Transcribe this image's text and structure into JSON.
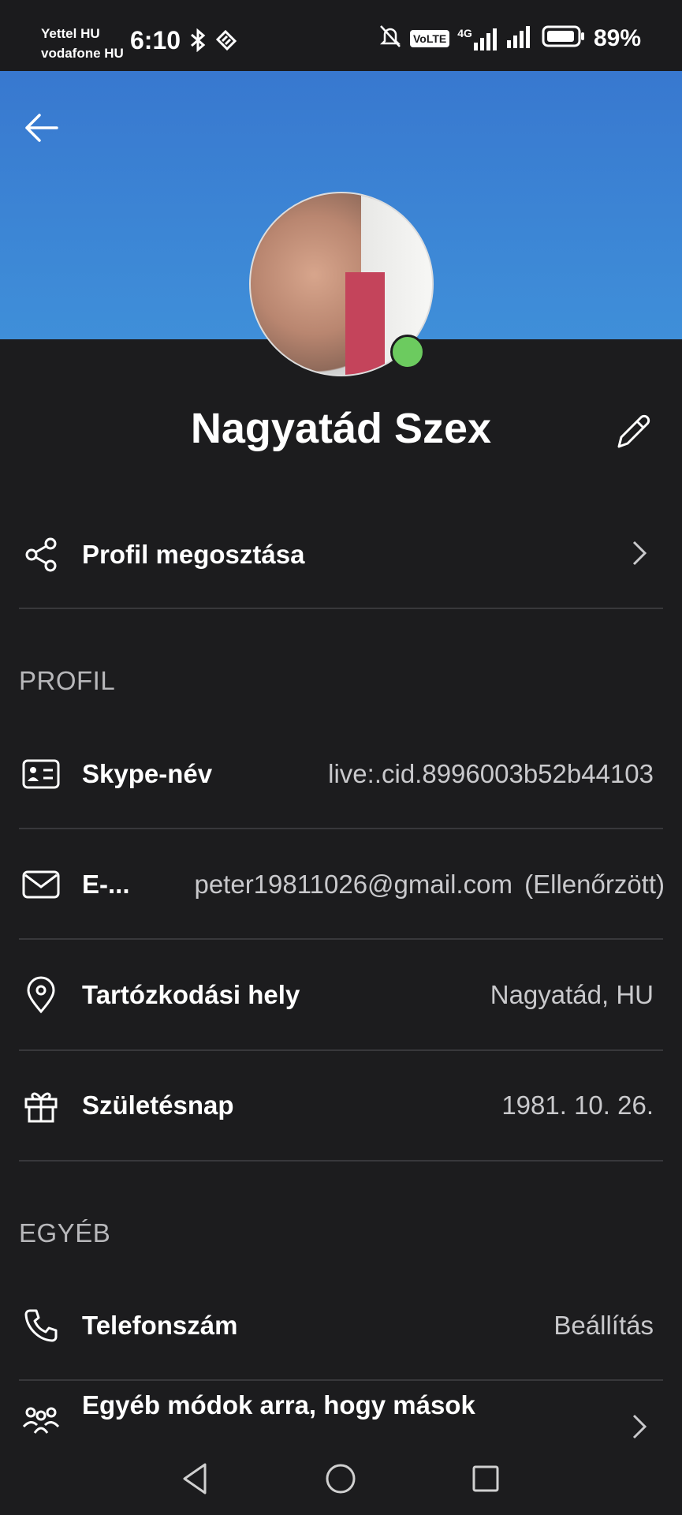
{
  "status": {
    "carrier1": "Yettel HU",
    "carrier2": "vodafone HU",
    "time": "6:10",
    "volte": "VoLTE",
    "network": "4G",
    "battery": "89%"
  },
  "profile": {
    "name": "Nagyatád Szex",
    "presence_color": "#6ccb5f"
  },
  "share": {
    "label": "Profil megosztása"
  },
  "sections": {
    "profil": "PROFIL",
    "egyeb": "EGYÉB"
  },
  "rows": {
    "skype": {
      "label": "Skype-név",
      "value": "live:.cid.8996003b52b44103"
    },
    "email": {
      "label": "E-...",
      "value": "peter19811026@gmail.com",
      "status": "(Ellenőrzött)"
    },
    "location": {
      "label": "Tartózkodási hely",
      "value": "Nagyatád, HU"
    },
    "birthday": {
      "label": "Születésnap",
      "value": "1981. 10. 26."
    },
    "phone": {
      "label": "Telefonszám",
      "value": "Beállítás"
    },
    "others": {
      "label": "Egyéb módok arra, hogy mások"
    }
  },
  "colors": {
    "header_top": "#3878cf",
    "header_bottom": "#3f8fd9",
    "background": "#1c1c1e"
  }
}
